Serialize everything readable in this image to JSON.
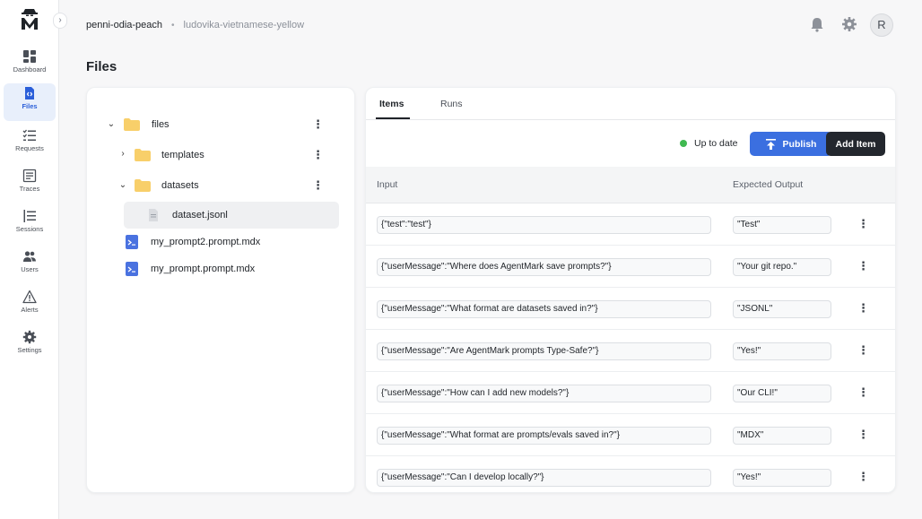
{
  "sidebar": {
    "collapse_glyph": "›",
    "items": [
      {
        "label": "Dashboard",
        "icon": "dashboard-icon"
      },
      {
        "label": "Files",
        "icon": "files-icon",
        "active": true
      },
      {
        "label": "Requests",
        "icon": "requests-icon"
      },
      {
        "label": "Traces",
        "icon": "traces-icon"
      },
      {
        "label": "Sessions",
        "icon": "sessions-icon"
      },
      {
        "label": "Users",
        "icon": "users-icon"
      },
      {
        "label": "Alerts",
        "icon": "alerts-icon"
      },
      {
        "label": "Settings",
        "icon": "settings-icon"
      }
    ]
  },
  "header": {
    "breadcrumb": [
      "penni-odia-peach",
      "ludovika-vietnamese-yellow"
    ],
    "separator": "•",
    "avatar_initial": "R"
  },
  "page": {
    "title": "Files"
  },
  "tree": {
    "root": "files",
    "templates": "templates",
    "datasets": "datasets",
    "dataset_file": "dataset.jsonl",
    "prompt2": "my_prompt2.prompt.mdx",
    "prompt1": "my_prompt.prompt.mdx",
    "menu_glyph": "⋮"
  },
  "tabs": {
    "items": "Items",
    "runs": "Runs"
  },
  "toolbar": {
    "status": "Up to date",
    "publish_label": "Publish",
    "add_item_label": "Add Item"
  },
  "table": {
    "columns": [
      "Input",
      "Expected Output"
    ],
    "rows": [
      {
        "input": "{\"test\":\"test\"}",
        "output": "\"Test\""
      },
      {
        "input": "{\"userMessage\":\"Where does AgentMark save prompts?\"}",
        "output": "\"Your git repo.\""
      },
      {
        "input": "{\"userMessage\":\"What format are datasets saved in?\"}",
        "output": "\"JSONL\""
      },
      {
        "input": "{\"userMessage\":\"Are AgentMark prompts Type-Safe?\"}",
        "output": "\"Yes!\""
      },
      {
        "input": "{\"userMessage\":\"How can I add new models?\"}",
        "output": "\"Our CLI!\""
      },
      {
        "input": "{\"userMessage\":\"What format are prompts/evals saved in?\"}",
        "output": "\"MDX\""
      },
      {
        "input": "{\"userMessage\":\"Can I develop locally?\"}",
        "output": "\"Yes!\""
      }
    ]
  },
  "colors": {
    "accent": "#3b6fe0",
    "dark_button": "#23272e",
    "status_ok": "#3fb950",
    "folder": "#f8cf6a",
    "file_mdx": "#4a72e0"
  }
}
